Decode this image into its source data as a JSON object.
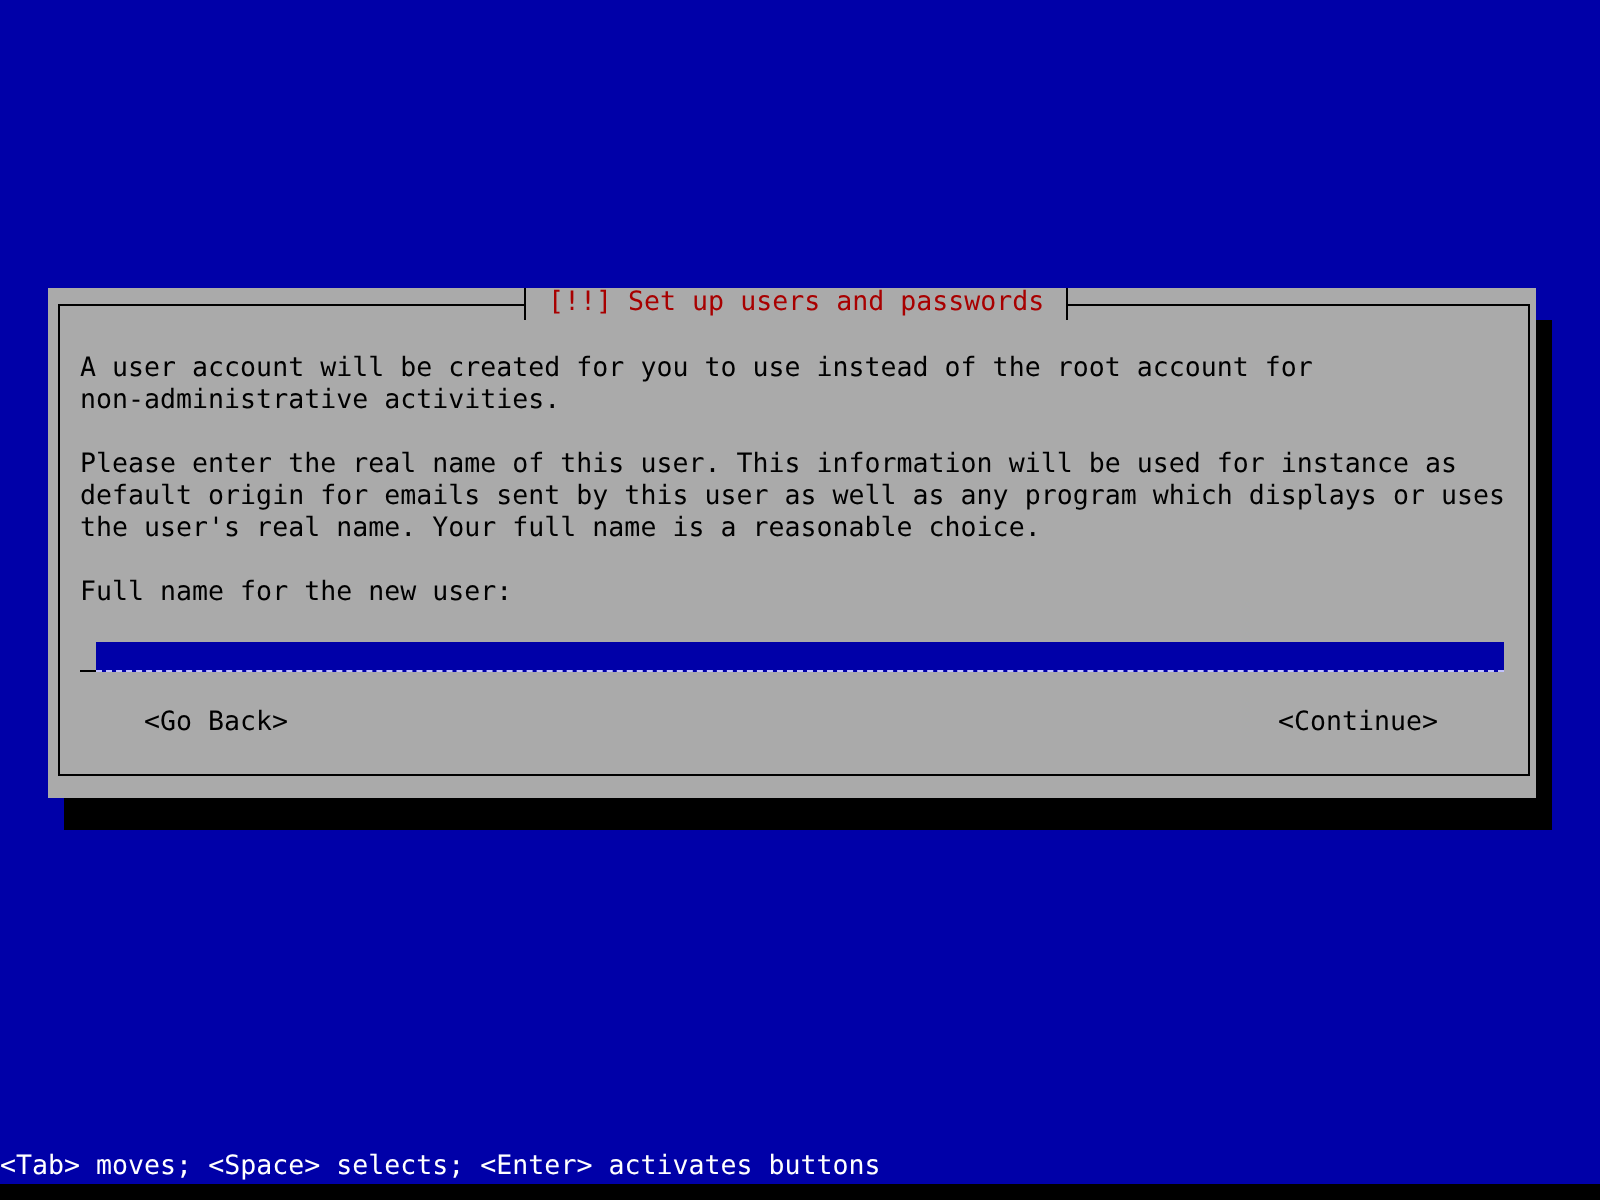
{
  "dialog": {
    "title": "[!!] Set up users and passwords",
    "paragraphs": [
      [
        "A user account will be created for you to use instead of the root account for",
        "non-administrative activities."
      ],
      [
        "Please enter the real name of this user. This information will be used for instance as",
        "default origin for emails sent by this user as well as any program which displays or uses",
        "the user's real name. Your full name is a reasonable choice."
      ]
    ],
    "field_label": "Full name for the new user:",
    "buttons": [
      {
        "label": "<Go Back>"
      },
      {
        "label": "<Continue>"
      }
    ]
  },
  "status_bar": "<Tab> moves; <Space> selects; <Enter> activates buttons"
}
